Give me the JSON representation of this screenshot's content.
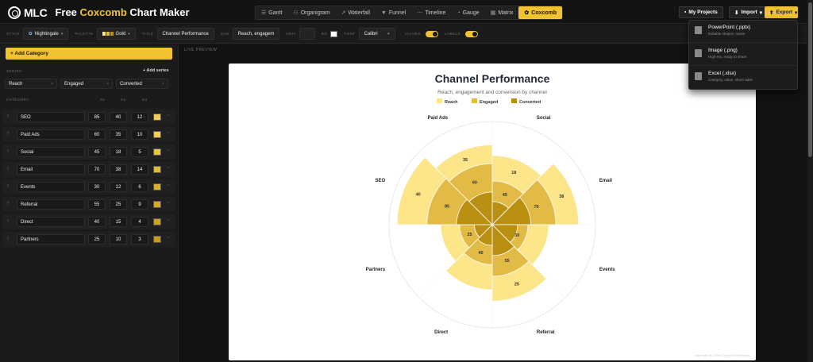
{
  "app": {
    "logo": "MLC",
    "title_prefix": "Free",
    "title_accent": "Coxcomb",
    "title_suffix": "Chart Maker"
  },
  "tabs": [
    {
      "label": "Gantt",
      "icon": "gantt-icon",
      "active": false
    },
    {
      "label": "Organigram",
      "icon": "organigram-icon",
      "active": false
    },
    {
      "label": "Waterfall",
      "icon": "waterfall-icon",
      "active": false
    },
    {
      "label": "Funnel",
      "icon": "funnel-icon",
      "active": false
    },
    {
      "label": "Timeline",
      "icon": "timeline-icon",
      "active": false
    },
    {
      "label": "Gauge",
      "icon": "gauge-icon",
      "active": false
    },
    {
      "label": "Matrix",
      "icon": "matrix-icon",
      "active": false
    },
    {
      "label": "Coxcomb",
      "icon": "coxcomb-icon",
      "active": true
    }
  ],
  "top_buttons": {
    "projects": "My Projects",
    "import": "Import",
    "export": "Export"
  },
  "toolbar": {
    "style_label": "STYLE",
    "style_value": "Nightingale",
    "palette_label": "PALETTE",
    "palette_value": "Gold",
    "title_label": "TITLE",
    "title_value": "Channel Performance",
    "sub_label": "SUB",
    "sub_value": "Reach, engagem",
    "unit_label": "UNIT",
    "unit_value": "",
    "bg_label": "BG",
    "font_label": "FONT",
    "font_value": "Calibri",
    "values_label": "VALUES",
    "labels_label": "LABELS"
  },
  "left_panel": {
    "add_category": "+ Add Category",
    "series_label": "SERIES",
    "add_series": "+ Add series",
    "series": [
      "Reach",
      "Engaged",
      "Converted"
    ],
    "col_category": "CATEGORY",
    "col_s1": "S1",
    "col_s2": "S2",
    "col_s3": "S3",
    "rows": [
      {
        "name": "SEO",
        "s1": "85",
        "s2": "40",
        "s3": "12",
        "color": "#f1cf58"
      },
      {
        "name": "Paid Ads",
        "s1": "60",
        "s2": "35",
        "s3": "10",
        "color": "#f1cf58"
      },
      {
        "name": "Social",
        "s1": "45",
        "s2": "18",
        "s3": "5",
        "color": "#e8c24a"
      },
      {
        "name": "Email",
        "s1": "70",
        "s2": "38",
        "s3": "14",
        "color": "#e0b83e"
      },
      {
        "name": "Events",
        "s1": "30",
        "s2": "12",
        "s3": "6",
        "color": "#d9b034"
      },
      {
        "name": "Referral",
        "s1": "55",
        "s2": "25",
        "s3": "9",
        "color": "#d4a92c"
      },
      {
        "name": "Direct",
        "s1": "40",
        "s2": "15",
        "s3": "4",
        "color": "#cfa126"
      },
      {
        "name": "Partners",
        "s1": "25",
        "s2": "10",
        "s3": "3",
        "color": "#c99a22"
      }
    ]
  },
  "preview_label": "LIVE PREVIEW",
  "export_menu": [
    {
      "title": "PowerPoint (.pptx)",
      "sub": "Editable shapes, native",
      "icon": "pptx-icon"
    },
    {
      "title": "Image (.png)",
      "sub": "High-res, ready to share",
      "icon": "image-icon"
    },
    {
      "title": "Excel (.xlsx)",
      "sub": "Category, value, share table",
      "icon": "excel-icon"
    }
  ],
  "chart_data": {
    "type": "coxcomb",
    "title": "Channel Performance",
    "subtitle": "Reach, engagement and conversion by channel",
    "categories": [
      "Social",
      "Email",
      "Events",
      "Referral",
      "Direct",
      "Partners",
      "SEO",
      "Paid Ads"
    ],
    "series": [
      {
        "name": "Reach",
        "color": "#fde58a",
        "values": [
          45,
          70,
          30,
          55,
          40,
          25,
          85,
          60
        ]
      },
      {
        "name": "Engaged",
        "color": "#e1bb46",
        "values": [
          18,
          38,
          12,
          25,
          15,
          10,
          40,
          35
        ]
      },
      {
        "name": "Converted",
        "color": "#b98f12",
        "values": [
          5,
          14,
          6,
          9,
          4,
          3,
          12,
          10
        ]
      }
    ],
    "value_labels": {
      "Reach": [
        45,
        70,
        30,
        55,
        40,
        25,
        85,
        60
      ],
      "Engaged": [
        18,
        38,
        null,
        25,
        null,
        null,
        40,
        35
      ]
    },
    "rmax": 100,
    "legend_position": "top",
    "grid_circle": true,
    "watermark": "Made with MLC Free Coxcomb Chart Maker"
  }
}
